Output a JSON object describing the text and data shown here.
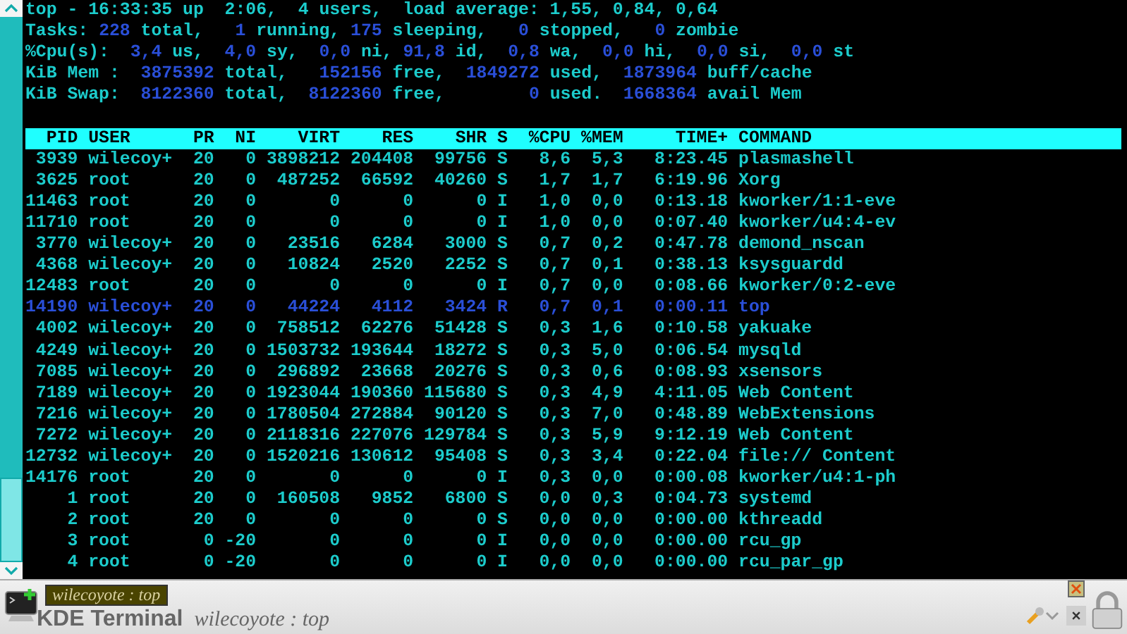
{
  "summary": [
    [
      {
        "text": "top - 16:33:35 up  2:06,  4 users,  load average: 1,55, 0,84, 0,64",
        "kind": "label"
      }
    ],
    [
      {
        "text": "Tasks: ",
        "kind": "label"
      },
      {
        "text": "228",
        "kind": "value"
      },
      {
        "text": " total,   ",
        "kind": "label"
      },
      {
        "text": "1",
        "kind": "value"
      },
      {
        "text": " running, ",
        "kind": "label"
      },
      {
        "text": "175",
        "kind": "value"
      },
      {
        "text": " sleeping,   ",
        "kind": "label"
      },
      {
        "text": "0",
        "kind": "value"
      },
      {
        "text": " stopped,   ",
        "kind": "label"
      },
      {
        "text": "0",
        "kind": "value"
      },
      {
        "text": " zombie",
        "kind": "label"
      }
    ],
    [
      {
        "text": "%Cpu(s):  ",
        "kind": "label"
      },
      {
        "text": "3,4",
        "kind": "value"
      },
      {
        "text": " us,  ",
        "kind": "label"
      },
      {
        "text": "4,0",
        "kind": "value"
      },
      {
        "text": " sy,  ",
        "kind": "label"
      },
      {
        "text": "0,0",
        "kind": "value"
      },
      {
        "text": " ni, ",
        "kind": "label"
      },
      {
        "text": "91,8",
        "kind": "value"
      },
      {
        "text": " id,  ",
        "kind": "label"
      },
      {
        "text": "0,8",
        "kind": "value"
      },
      {
        "text": " wa,  ",
        "kind": "label"
      },
      {
        "text": "0,0",
        "kind": "value"
      },
      {
        "text": " hi,  ",
        "kind": "label"
      },
      {
        "text": "0,0",
        "kind": "value"
      },
      {
        "text": " si,  ",
        "kind": "label"
      },
      {
        "text": "0,0",
        "kind": "value"
      },
      {
        "text": " st",
        "kind": "label"
      }
    ],
    [
      {
        "text": "KiB Mem :  ",
        "kind": "label"
      },
      {
        "text": "3875392",
        "kind": "value"
      },
      {
        "text": " total,   ",
        "kind": "label"
      },
      {
        "text": "152156",
        "kind": "value"
      },
      {
        "text": " free,  ",
        "kind": "label"
      },
      {
        "text": "1849272",
        "kind": "value"
      },
      {
        "text": " used,  ",
        "kind": "label"
      },
      {
        "text": "1873964",
        "kind": "value"
      },
      {
        "text": " buff/cache",
        "kind": "label"
      }
    ],
    [
      {
        "text": "KiB Swap:  ",
        "kind": "label"
      },
      {
        "text": "8122360",
        "kind": "value"
      },
      {
        "text": " total,  ",
        "kind": "label"
      },
      {
        "text": "8122360",
        "kind": "value"
      },
      {
        "text": " free,        ",
        "kind": "label"
      },
      {
        "text": "0",
        "kind": "value"
      },
      {
        "text": " used.  ",
        "kind": "label"
      },
      {
        "text": "1668364",
        "kind": "value"
      },
      {
        "text": " avail Mem",
        "kind": "label"
      }
    ]
  ],
  "table": {
    "columns": [
      "PID",
      "USER",
      "PR",
      "NI",
      "VIRT",
      "RES",
      "SHR",
      "S",
      "%CPU",
      "%MEM",
      "TIME+",
      "COMMAND"
    ],
    "rows": [
      {
        "highlighted": false,
        "cells": [
          "3939",
          "wilecoy+",
          "20",
          "0",
          "3898212",
          "204408",
          "99756",
          "S",
          "8,6",
          "5,3",
          "8:23.45",
          "plasmashell"
        ]
      },
      {
        "highlighted": false,
        "cells": [
          "3625",
          "root",
          "20",
          "0",
          "487252",
          "66592",
          "40260",
          "S",
          "1,7",
          "1,7",
          "6:19.96",
          "Xorg"
        ]
      },
      {
        "highlighted": false,
        "cells": [
          "11463",
          "root",
          "20",
          "0",
          "0",
          "0",
          "0",
          "I",
          "1,0",
          "0,0",
          "0:13.18",
          "kworker/1:1-eve"
        ]
      },
      {
        "highlighted": false,
        "cells": [
          "11710",
          "root",
          "20",
          "0",
          "0",
          "0",
          "0",
          "I",
          "1,0",
          "0,0",
          "0:07.40",
          "kworker/u4:4-ev"
        ]
      },
      {
        "highlighted": false,
        "cells": [
          "3770",
          "wilecoy+",
          "20",
          "0",
          "23516",
          "6284",
          "3000",
          "S",
          "0,7",
          "0,2",
          "0:47.78",
          "demond_nscan"
        ]
      },
      {
        "highlighted": false,
        "cells": [
          "4368",
          "wilecoy+",
          "20",
          "0",
          "10824",
          "2520",
          "2252",
          "S",
          "0,7",
          "0,1",
          "0:38.13",
          "ksysguardd"
        ]
      },
      {
        "highlighted": false,
        "cells": [
          "12483",
          "root",
          "20",
          "0",
          "0",
          "0",
          "0",
          "I",
          "0,7",
          "0,0",
          "0:08.66",
          "kworker/0:2-eve"
        ]
      },
      {
        "highlighted": true,
        "cells": [
          "14190",
          "wilecoy+",
          "20",
          "0",
          "44224",
          "4112",
          "3424",
          "R",
          "0,7",
          "0,1",
          "0:00.11",
          "top"
        ]
      },
      {
        "highlighted": false,
        "cells": [
          "4002",
          "wilecoy+",
          "20",
          "0",
          "758512",
          "62276",
          "51428",
          "S",
          "0,3",
          "1,6",
          "0:10.58",
          "yakuake"
        ]
      },
      {
        "highlighted": false,
        "cells": [
          "4249",
          "wilecoy+",
          "20",
          "0",
          "1503732",
          "193644",
          "18272",
          "S",
          "0,3",
          "5,0",
          "0:06.54",
          "mysqld"
        ]
      },
      {
        "highlighted": false,
        "cells": [
          "7085",
          "wilecoy+",
          "20",
          "0",
          "296892",
          "23668",
          "20276",
          "S",
          "0,3",
          "0,6",
          "0:08.93",
          "xsensors"
        ]
      },
      {
        "highlighted": false,
        "cells": [
          "7189",
          "wilecoy+",
          "20",
          "0",
          "1923044",
          "190360",
          "115680",
          "S",
          "0,3",
          "4,9",
          "4:11.05",
          "Web Content"
        ]
      },
      {
        "highlighted": false,
        "cells": [
          "7216",
          "wilecoy+",
          "20",
          "0",
          "1780504",
          "272884",
          "90120",
          "S",
          "0,3",
          "7,0",
          "0:48.89",
          "WebExtensions"
        ]
      },
      {
        "highlighted": false,
        "cells": [
          "7272",
          "wilecoy+",
          "20",
          "0",
          "2118316",
          "227076",
          "129784",
          "S",
          "0,3",
          "5,9",
          "9:12.19",
          "Web Content"
        ]
      },
      {
        "highlighted": false,
        "cells": [
          "12732",
          "wilecoy+",
          "20",
          "0",
          "1520216",
          "130612",
          "95408",
          "S",
          "0,3",
          "3,4",
          "0:22.04",
          "file:// Content"
        ]
      },
      {
        "highlighted": false,
        "cells": [
          "14176",
          "root",
          "20",
          "0",
          "0",
          "0",
          "0",
          "I",
          "0,3",
          "0,0",
          "0:00.08",
          "kworker/u4:1-ph"
        ]
      },
      {
        "highlighted": false,
        "cells": [
          "1",
          "root",
          "20",
          "0",
          "160508",
          "9852",
          "6800",
          "S",
          "0,0",
          "0,3",
          "0:04.73",
          "systemd"
        ]
      },
      {
        "highlighted": false,
        "cells": [
          "2",
          "root",
          "20",
          "0",
          "0",
          "0",
          "0",
          "S",
          "0,0",
          "0,0",
          "0:00.00",
          "kthreadd"
        ]
      },
      {
        "highlighted": false,
        "cells": [
          "3",
          "root",
          "0",
          "-20",
          "0",
          "0",
          "0",
          "I",
          "0,0",
          "0,0",
          "0:00.00",
          "rcu_gp"
        ]
      },
      {
        "highlighted": false,
        "cells": [
          "4",
          "root",
          "0",
          "-20",
          "0",
          "0",
          "0",
          "I",
          "0,0",
          "0,0",
          "0:00.00",
          "rcu_par_gp"
        ]
      }
    ]
  },
  "bottom_bar": {
    "tabs": [
      {
        "label": "wilecoyote : top",
        "selected": true
      }
    ],
    "app_name": "KDE Terminal",
    "window_title": "wilecoyote : top"
  }
}
